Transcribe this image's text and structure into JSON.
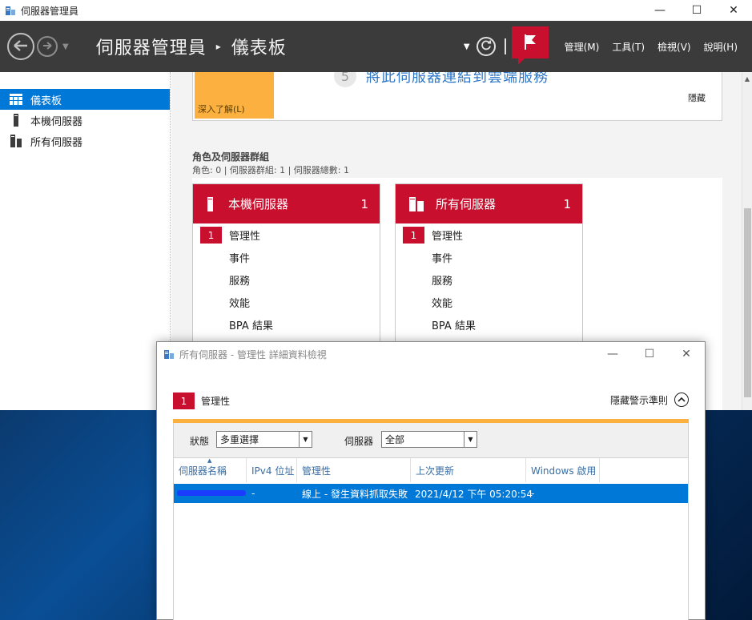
{
  "window": {
    "title": "伺服器管理員",
    "minimize": "—",
    "maximize": "☐",
    "close": "✕"
  },
  "header": {
    "breadcrumb_root": "伺服器管理員",
    "breadcrumb_sep": "▸",
    "breadcrumb_current": "儀表板",
    "menus": [
      "管理(M)",
      "工具(T)",
      "檢視(V)",
      "說明(H)"
    ]
  },
  "sidebar": {
    "items": [
      {
        "label": "儀表板",
        "icon": "dashboard-icon"
      },
      {
        "label": "本機伺服器",
        "icon": "server-icon"
      },
      {
        "label": "所有伺服器",
        "icon": "servers-icon"
      }
    ]
  },
  "welcome": {
    "learn_more": "深入了解(L)",
    "step_number": "5",
    "step_text": "將此伺服器連結到雲端服務",
    "hide": "隱藏"
  },
  "roles": {
    "heading": "角色及伺服器群組",
    "summary": "角色: 0 | 伺服器群組: 1 | 伺服器總數: 1",
    "cards": [
      {
        "title": "本機伺服器",
        "count": "1",
        "rows": [
          {
            "label": "管理性",
            "badge": "1"
          },
          {
            "label": "事件"
          },
          {
            "label": "服務"
          },
          {
            "label": "效能"
          },
          {
            "label": "BPA 結果"
          }
        ]
      },
      {
        "title": "所有伺服器",
        "count": "1",
        "rows": [
          {
            "label": "管理性",
            "badge": "1"
          },
          {
            "label": "事件"
          },
          {
            "label": "服務"
          },
          {
            "label": "效能"
          },
          {
            "label": "BPA 結果"
          }
        ]
      }
    ]
  },
  "dialog": {
    "title": "所有伺服器 - 管理性 詳細資料檢視",
    "minimize": "—",
    "maximize": "☐",
    "close": "✕",
    "badge": "1",
    "label": "管理性",
    "hide_criteria": "隱藏警示準則",
    "filters": {
      "status_label": "狀態",
      "status_value": "多重選擇",
      "server_label": "伺服器",
      "server_value": "全部"
    },
    "columns": [
      "伺服器名稱",
      "IPv4 位址",
      "管理性",
      "上次更新",
      "Windows 啟用"
    ],
    "rows": [
      {
        "name": "",
        "ipv4": "-",
        "manageability": "線上 - 發生資料抓取失敗",
        "last_update": "2021/4/12 下午 05:20:54",
        "activation": "-"
      }
    ]
  },
  "colors": {
    "accent_red": "#c8102e",
    "selection_blue": "#0078d7",
    "header_dark": "#3b3b3b",
    "orange": "#fbb040",
    "link_blue": "#2e77c8"
  }
}
